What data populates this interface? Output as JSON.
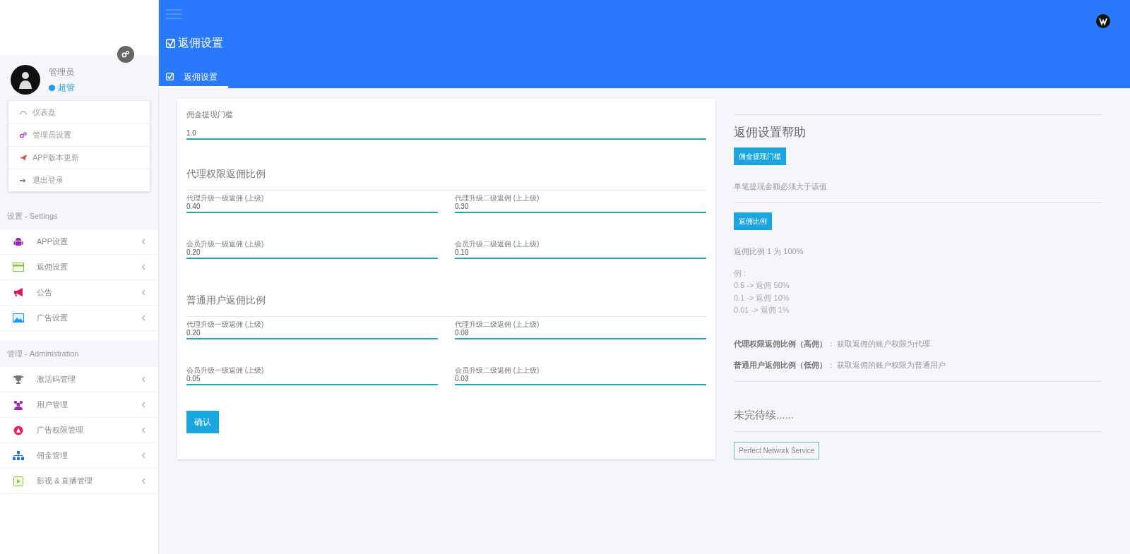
{
  "sidebar": {
    "profile": {
      "role": "管理员",
      "badge": "超管"
    },
    "quick_menu": [
      {
        "label": "仪表盘"
      },
      {
        "label": "管理员设置"
      },
      {
        "label": "APP版本更新"
      },
      {
        "label": "退出登录"
      }
    ],
    "sections": [
      {
        "title": "设置 - Settings",
        "items": [
          {
            "label": "APP设置"
          },
          {
            "label": "返佣设置"
          },
          {
            "label": "公告"
          },
          {
            "label": "广告设置"
          }
        ]
      },
      {
        "title": "管理 - Administration",
        "items": [
          {
            "label": "激活码管理"
          },
          {
            "label": "用户管理"
          },
          {
            "label": "广告权限管理"
          },
          {
            "label": "佣金管理"
          },
          {
            "label": "影视 & 直播管理"
          }
        ]
      }
    ]
  },
  "header": {
    "page_title": "返佣设置",
    "tabs": [
      {
        "label": "返佣设置",
        "selected": true
      }
    ]
  },
  "form": {
    "threshold": {
      "label": "佣金提现门槛",
      "value": "1.0"
    },
    "sections": [
      {
        "title": "代理权限返佣比例",
        "fields": [
          {
            "label": "代理升级一级返佣 (上级)",
            "value": "0.40"
          },
          {
            "label": "代理升级二级返佣 (上上级)",
            "value": "0.30"
          },
          {
            "label": "会员升级一级返佣 (上级)",
            "value": "0.20"
          },
          {
            "label": "会员升级二级返佣 (上上级)",
            "value": "0.10"
          }
        ]
      },
      {
        "title": "普通用户返佣比例",
        "fields": [
          {
            "label": "代理升级一级返佣 (上级)",
            "value": "0.20"
          },
          {
            "label": "代理升级二级返佣 (上上级)",
            "value": "0.08"
          },
          {
            "label": "会员升级一级返佣 (上级)",
            "value": "0.05"
          },
          {
            "label": "会员升级二级返佣 (上上级)",
            "value": "0.03"
          }
        ]
      }
    ],
    "submit": "确认"
  },
  "help": [
    {
      "kind": "rule"
    },
    {
      "kind": "heading",
      "text": "返佣设置帮助"
    },
    {
      "kind": "badge",
      "text": "佣金提现门槛"
    },
    {
      "kind": "text",
      "text": "单笔提现金额必须大于该值"
    },
    {
      "kind": "rule"
    },
    {
      "kind": "badge",
      "text": "返佣比例"
    },
    {
      "kind": "text",
      "text": "返佣比例 1 为 100%"
    },
    {
      "kind": "lines",
      "lines": [
        "例 :",
        "0.5 -> 返佣 50%",
        "0.1 -> 返佣 10%",
        "0.01 -> 返佣 1%"
      ]
    },
    {
      "kind": "text",
      "text": "**代理权限返佣比例（高佣）**： 获取返佣的账户权限为代理"
    },
    {
      "kind": "text",
      "text": "**普通用户返佣比例（低佣）**： 获取返佣的账户权限为普通用户"
    },
    {
      "kind": "rule"
    },
    {
      "kind": "heading",
      "text": "未完待续......"
    },
    {
      "kind": "rule"
    },
    {
      "kind": "outline",
      "text": "Perfect Network Service"
    }
  ]
}
